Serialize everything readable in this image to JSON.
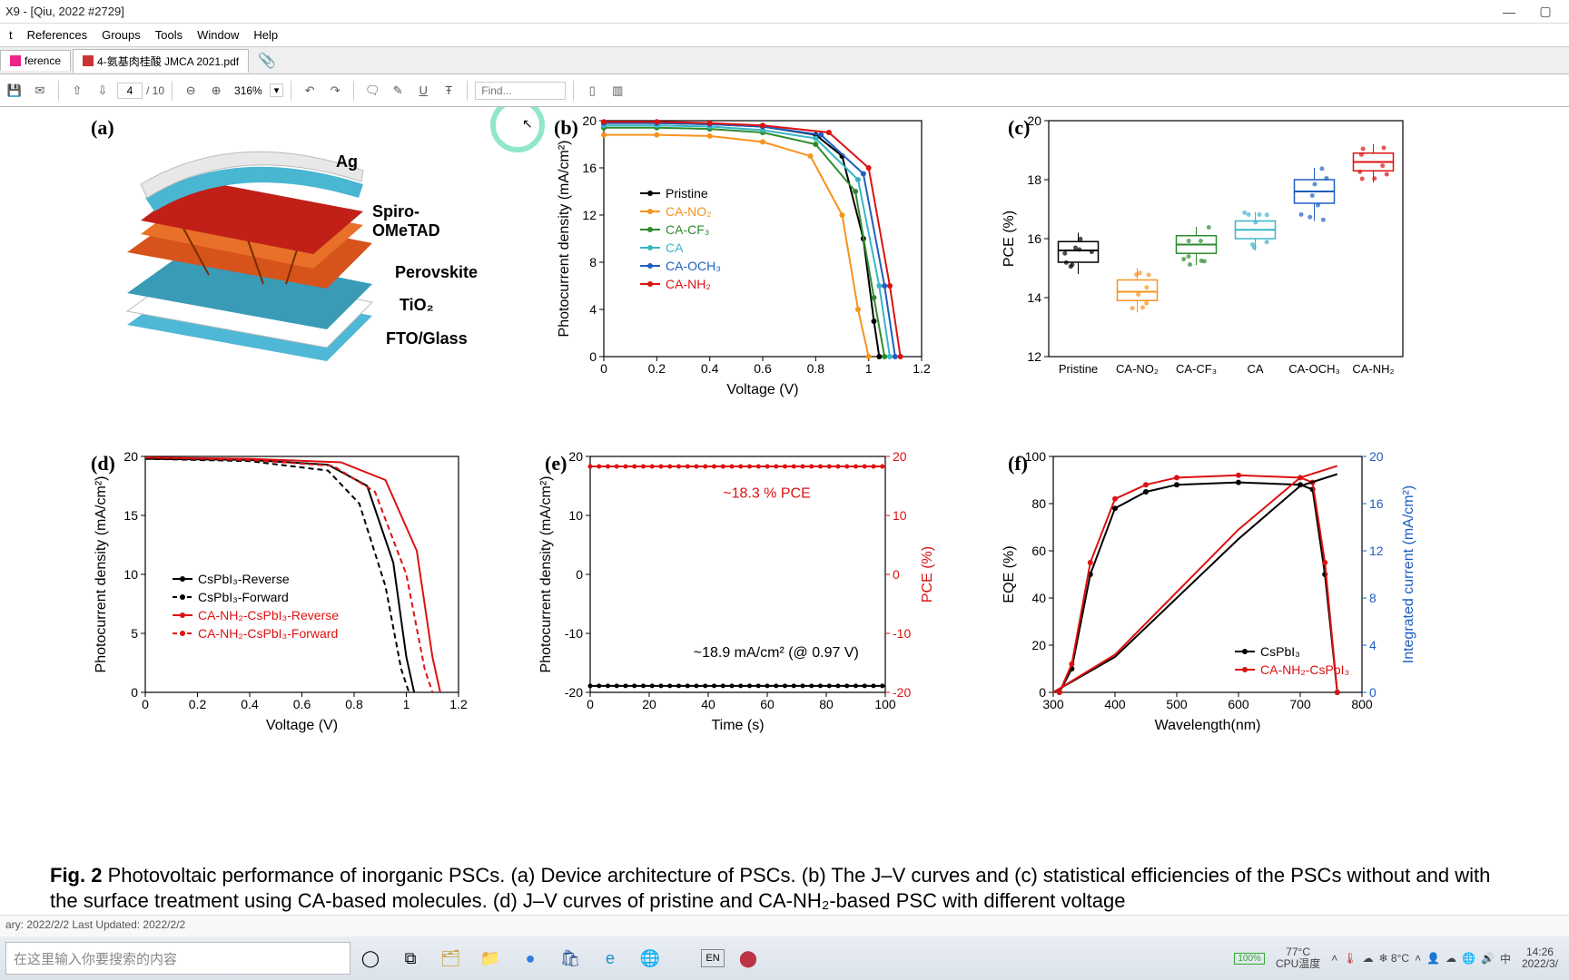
{
  "window": {
    "title": "X9 - [Qiu, 2022 #2729]"
  },
  "menu": {
    "m0": "t",
    "m1": "References",
    "m2": "Groups",
    "m3": "Tools",
    "m4": "Window",
    "m5": "Help"
  },
  "tabs": {
    "t0": "ference",
    "t1": "4-氨基肉桂酸  JMCA 2021.pdf"
  },
  "page": {
    "current": "4",
    "total": "/ 10"
  },
  "zoom": {
    "value": "316%"
  },
  "find": {
    "placeholder": "Find..."
  },
  "statusbar": {
    "text": "ary: 2022/2/2    Last Updated: 2022/2/2"
  },
  "taskbar": {
    "search_placeholder": "在这里输入你要搜索的内容"
  },
  "tray": {
    "battery": "100%",
    "weather_temp": "77°C",
    "weather_label": "CPU温度",
    "temp2": "8°C",
    "ime": "中",
    "lang": "EN",
    "time": "14:26",
    "date": "2022/3/"
  },
  "panels": {
    "a": "(a)",
    "b": "(b)",
    "c": "(c)",
    "d": "(d)",
    "e": "(e)",
    "f": "(f)"
  },
  "device_labels": {
    "ag": "Ag",
    "spiro": "Spiro-OMeTAD",
    "perov": "Perovskite",
    "tio2": "TiO₂",
    "fto": "FTO/Glass"
  },
  "caption": {
    "lead": "Fig. 2",
    "text": "   Photovoltaic performance of inorganic PSCs. (a) Device architecture of PSCs. (b) The J–V curves and (c) statistical efficiencies of the PSCs without and with the surface treatment using CA-based molecules. (d) J–V curves of pristine and CA-NH₂-based PSC with different voltage"
  },
  "chart_data": [
    {
      "id": "b",
      "type": "line",
      "title": "",
      "xlabel": "Voltage (V)",
      "ylabel": "Photocurrent density (mA/cm²)",
      "xlim": [
        0.0,
        1.2
      ],
      "ylim": [
        0,
        20
      ],
      "xticks": [
        0.0,
        0.2,
        0.4,
        0.6,
        0.8,
        1.0,
        1.2
      ],
      "yticks": [
        0,
        4,
        8,
        12,
        16,
        20
      ],
      "series": [
        {
          "name": "Pristine",
          "color": "#000",
          "x": [
            0.0,
            0.2,
            0.4,
            0.6,
            0.8,
            0.9,
            0.98,
            1.02,
            1.04
          ],
          "y": [
            19.8,
            19.8,
            19.7,
            19.5,
            18.8,
            17.0,
            10,
            3,
            0
          ]
        },
        {
          "name": "CA-NO₂",
          "color": "#f7931e",
          "x": [
            0.0,
            0.2,
            0.4,
            0.6,
            0.78,
            0.9,
            0.96,
            1.0
          ],
          "y": [
            18.8,
            18.8,
            18.7,
            18.2,
            17.0,
            12,
            4,
            0
          ]
        },
        {
          "name": "CA-CF₃",
          "color": "#2e8b2e",
          "x": [
            0.0,
            0.2,
            0.4,
            0.6,
            0.8,
            0.95,
            1.02,
            1.06
          ],
          "y": [
            19.4,
            19.4,
            19.3,
            19.0,
            18.0,
            14,
            5,
            0
          ]
        },
        {
          "name": "CA",
          "color": "#38b6c8",
          "x": [
            0.0,
            0.2,
            0.4,
            0.6,
            0.8,
            0.96,
            1.04,
            1.08
          ],
          "y": [
            19.6,
            19.6,
            19.5,
            19.2,
            18.5,
            15,
            6,
            0
          ]
        },
        {
          "name": "CA-OCH₃",
          "color": "#1e5fbf",
          "x": [
            0.0,
            0.2,
            0.4,
            0.6,
            0.82,
            0.98,
            1.06,
            1.1
          ],
          "y": [
            19.8,
            19.8,
            19.7,
            19.5,
            18.8,
            15.5,
            6,
            0
          ]
        },
        {
          "name": "CA-NH₂",
          "color": "#d11",
          "x": [
            0.0,
            0.2,
            0.4,
            0.6,
            0.85,
            1.0,
            1.08,
            1.12
          ],
          "y": [
            19.9,
            19.9,
            19.8,
            19.6,
            19.0,
            16,
            6,
            0
          ]
        }
      ]
    },
    {
      "id": "c",
      "type": "box",
      "xlabel": "",
      "ylabel": "PCE (%)",
      "ylim": [
        12,
        20
      ],
      "yticks": [
        12,
        14,
        16,
        18,
        20
      ],
      "categories": [
        "Pristine",
        "CA-NO₂",
        "CA-CF₃",
        "CA",
        "CA-OCH₃",
        "CA-NH₂"
      ],
      "series": [
        {
          "name": "Pristine",
          "color": "#000",
          "q1": 15.2,
          "median": 15.6,
          "q3": 15.9,
          "low": 14.8,
          "high": 16.2
        },
        {
          "name": "CA-NO₂",
          "color": "#f7931e",
          "q1": 13.9,
          "median": 14.2,
          "q3": 14.6,
          "low": 13.5,
          "high": 15.0
        },
        {
          "name": "CA-CF₃",
          "color": "#2e8b2e",
          "q1": 15.5,
          "median": 15.8,
          "q3": 16.1,
          "low": 15.1,
          "high": 16.4
        },
        {
          "name": "CA",
          "color": "#38b6c8",
          "q1": 16.0,
          "median": 16.3,
          "q3": 16.6,
          "low": 15.6,
          "high": 16.9
        },
        {
          "name": "CA-OCH₃",
          "color": "#1e5fbf",
          "q1": 17.2,
          "median": 17.6,
          "q3": 18.0,
          "low": 16.6,
          "high": 18.4
        },
        {
          "name": "CA-NH₂",
          "color": "#d11",
          "q1": 18.3,
          "median": 18.6,
          "q3": 18.9,
          "low": 17.9,
          "high": 19.2
        }
      ]
    },
    {
      "id": "d",
      "type": "line",
      "xlabel": "Voltage (V)",
      "ylabel": "Photocurrent density (mA/cm²)",
      "xlim": [
        0.0,
        1.2
      ],
      "ylim": [
        0,
        20
      ],
      "xticks": [
        0.0,
        0.2,
        0.4,
        0.6,
        0.8,
        1.0,
        1.2
      ],
      "yticks": [
        0,
        5,
        10,
        15,
        20
      ],
      "series": [
        {
          "name": "CsPbI₃-Reverse",
          "color": "#000",
          "style": "solid",
          "x": [
            0,
            0.4,
            0.7,
            0.85,
            0.95,
            1.0,
            1.03
          ],
          "y": [
            19.8,
            19.7,
            19.3,
            17.5,
            11,
            3,
            0
          ]
        },
        {
          "name": "CsPbI₃-Forward",
          "color": "#000",
          "style": "dash",
          "x": [
            0,
            0.4,
            0.7,
            0.82,
            0.92,
            0.98,
            1.01
          ],
          "y": [
            19.8,
            19.6,
            18.8,
            16,
            9,
            2,
            0
          ]
        },
        {
          "name": "CA-NH₂-CsPbI₃-Reverse",
          "color": "#d11",
          "style": "solid",
          "x": [
            0,
            0.4,
            0.75,
            0.92,
            1.04,
            1.1,
            1.13
          ],
          "y": [
            19.9,
            19.8,
            19.5,
            18,
            12,
            3,
            0
          ]
        },
        {
          "name": "CA-NH₂-CsPbI₃-Forward",
          "color": "#d11",
          "style": "dash",
          "x": [
            0,
            0.4,
            0.72,
            0.88,
            1.0,
            1.07,
            1.1
          ],
          "y": [
            19.9,
            19.7,
            19.2,
            17,
            10,
            2,
            0
          ]
        }
      ]
    },
    {
      "id": "e",
      "type": "line",
      "xlabel": "Time (s)",
      "ylabel": "Photocurrent density (mA/cm²)",
      "ylabel2": "PCE (%)",
      "xlim": [
        0,
        100
      ],
      "ylim": [
        -20,
        20
      ],
      "ylim2": [
        -20,
        20
      ],
      "xticks": [
        0,
        20,
        40,
        60,
        80,
        100
      ],
      "yticks": [
        -20,
        -10,
        0,
        10,
        20
      ],
      "annotations": [
        "~18.3 % PCE",
        "~18.9 mA/cm² (@ 0.97 V)"
      ],
      "series": [
        {
          "name": "PCE",
          "color": "#d11",
          "x": [
            0,
            100
          ],
          "y": [
            18.3,
            18.3
          ]
        },
        {
          "name": "J",
          "color": "#000",
          "x": [
            0,
            100
          ],
          "y": [
            -18.9,
            -18.9
          ]
        }
      ]
    },
    {
      "id": "f",
      "type": "line",
      "xlabel": "Wavelength(nm)",
      "ylabel": "EQE (%)",
      "ylabel2": "Integrated current (mA/cm²)",
      "xlim": [
        300,
        800
      ],
      "ylim": [
        0,
        100
      ],
      "ylim2": [
        0,
        20
      ],
      "xticks": [
        300,
        400,
        500,
        600,
        700,
        800
      ],
      "yticks": [
        0,
        20,
        40,
        60,
        80,
        100
      ],
      "y2ticks": [
        0,
        4,
        8,
        12,
        16,
        20
      ],
      "legend": [
        "CsPbI₃",
        "CA-NH₂-CsPbI₃"
      ],
      "series": [
        {
          "name": "EQE CsPbI₃",
          "color": "#000",
          "x": [
            310,
            330,
            360,
            400,
            450,
            500,
            600,
            700,
            720,
            740,
            760
          ],
          "y": [
            0,
            10,
            50,
            78,
            85,
            88,
            89,
            88,
            86,
            50,
            0
          ]
        },
        {
          "name": "EQE CA-NH₂",
          "color": "#d11",
          "x": [
            310,
            330,
            360,
            400,
            450,
            500,
            600,
            700,
            720,
            740,
            760
          ],
          "y": [
            0,
            12,
            55,
            82,
            88,
            91,
            92,
            91,
            89,
            55,
            0
          ]
        },
        {
          "name": "Int CsPbI₃",
          "color": "#000",
          "axis": "y2",
          "x": [
            300,
            400,
            500,
            600,
            700,
            760
          ],
          "y": [
            0,
            3,
            8,
            13,
            17.5,
            18.5
          ]
        },
        {
          "name": "Int CA-NH₂",
          "color": "#d11",
          "axis": "y2",
          "x": [
            300,
            400,
            500,
            600,
            700,
            760
          ],
          "y": [
            0,
            3.2,
            8.5,
            13.8,
            18.2,
            19.2
          ]
        }
      ]
    }
  ]
}
